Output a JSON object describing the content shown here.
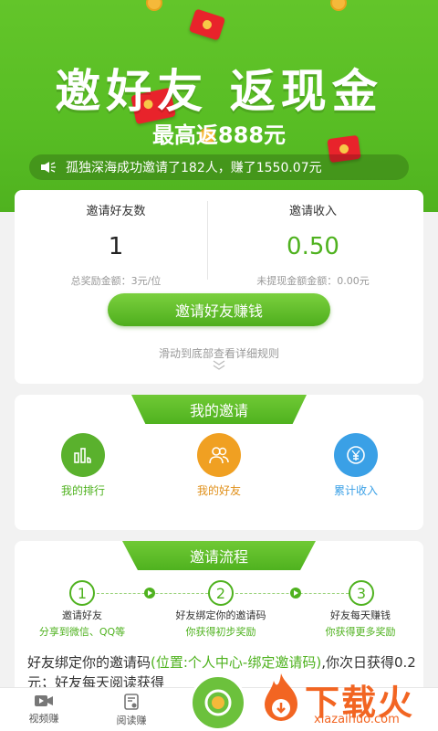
{
  "hero": {
    "title": "邀好友 返现金",
    "subtitle": "最高返888元",
    "ticker": "孤独深海成功邀请了182人，赚了1550.07元"
  },
  "stats": {
    "left": {
      "label": "邀请好友数",
      "value": "1",
      "note": "总奖励金额：3元/位"
    },
    "right": {
      "label": "邀请收入",
      "value": "0.50",
      "note": "未提现金额金额：0.00元"
    },
    "cta": "邀请好友赚钱",
    "hint": "滑动到底部查看详细规则"
  },
  "invites": {
    "title": "我的邀请",
    "items": [
      {
        "label": "我的排行",
        "color": "#5ab12d"
      },
      {
        "label": "我的好友",
        "color": "#f0a022"
      },
      {
        "label": "累计收入",
        "color": "#3aa0e6"
      }
    ]
  },
  "flow": {
    "title": "邀请流程",
    "steps": [
      {
        "num": "1",
        "title": "邀请好友",
        "sub": "分享到微信、QQ等"
      },
      {
        "num": "2",
        "title": "好友绑定你的邀请码",
        "sub": "你获得初步奖励"
      },
      {
        "num": "3",
        "title": "好友每天赚钱",
        "sub": "你获得更多奖励"
      }
    ],
    "desc_a": "好友绑定你的邀请码",
    "desc_hl": "(位置:个人中心-绑定邀请码)",
    "desc_b": ",你次日获得0.2元；好友每天阅读获",
    "desc_c": "得"
  },
  "tabbar": {
    "tabs": [
      {
        "label": "视频赚"
      },
      {
        "label": "阅读赚"
      }
    ]
  },
  "watermark": {
    "brand": "下载火",
    "site": "xiazaihuo.com"
  },
  "colors": {
    "accent": "#4fb21f",
    "orange": "#f0a022",
    "blue": "#3aa0e6",
    "red": "#e8232b"
  }
}
